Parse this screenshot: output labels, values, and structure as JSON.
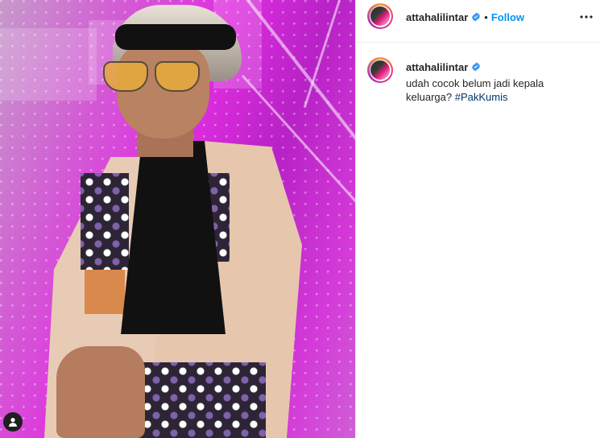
{
  "post": {
    "username": "attahalilintar",
    "follow_label": "Follow",
    "separator": "•",
    "caption": "udah cocok belum jadi kepala keluarga?",
    "hashtag": "#PakKumis"
  },
  "colors": {
    "follow": "#0095f6",
    "hashtag": "#00376b",
    "verified": "#3897f0",
    "text": "#262626"
  },
  "icons": {
    "verified": "verified-badge-icon",
    "more": "more-options-icon",
    "user": "user-tag-icon"
  }
}
